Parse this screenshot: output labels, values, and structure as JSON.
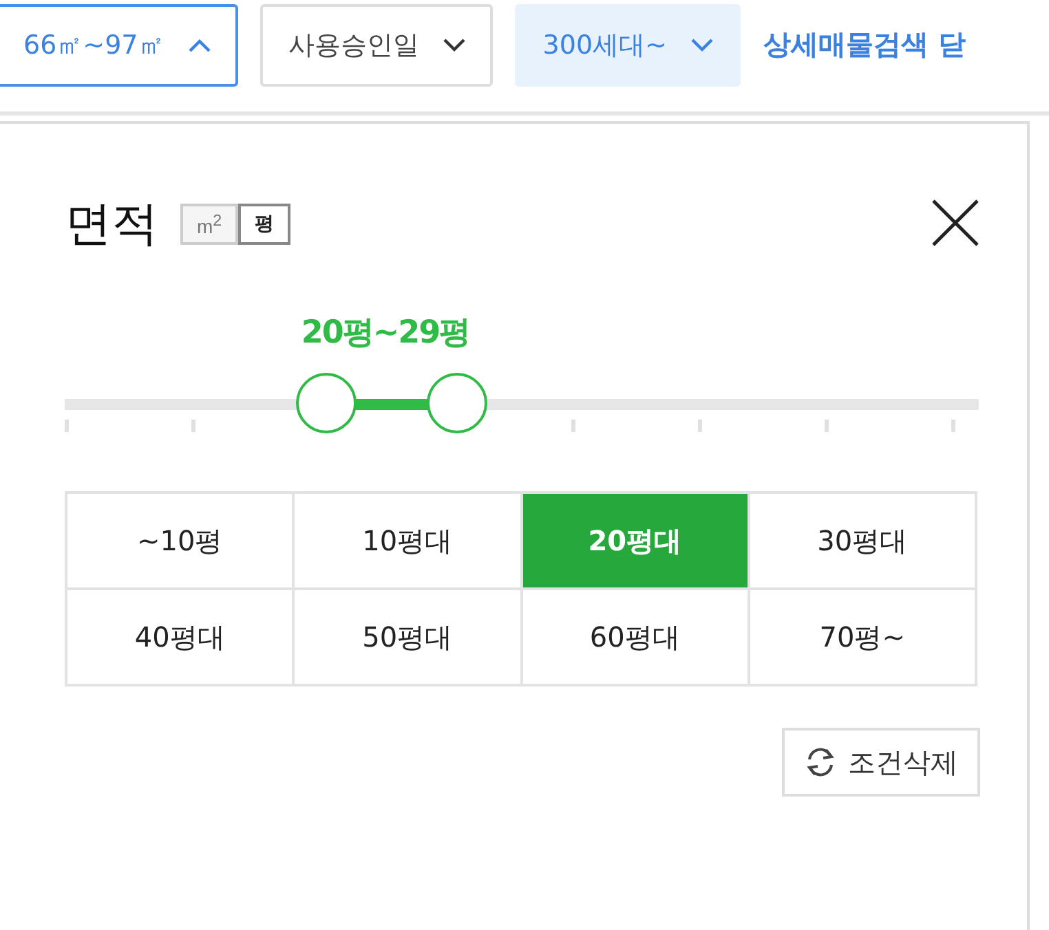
{
  "filters": [
    {
      "label": "66㎡~97㎡",
      "kind": "active",
      "expanded": true
    },
    {
      "label": "사용승인일",
      "kind": "plain",
      "expanded": false
    },
    {
      "label": "300세대~",
      "kind": "applied",
      "expanded": false
    }
  ],
  "detail_link": "상세매물검색 닫",
  "panel": {
    "title": "면적",
    "units": [
      {
        "label": "m$^{2}$",
        "selected": false
      },
      {
        "label": "평",
        "selected": true
      }
    ],
    "range_label": "20평~29평",
    "range": {
      "low": {
        "level": 0.2857
      },
      "high": {
        "level": 0.4286
      }
    },
    "options": [
      {
        "label": "~10평",
        "selected": false
      },
      {
        "label": "10평대",
        "selected": false
      },
      {
        "label": "20평대",
        "selected": true
      },
      {
        "label": "30평대",
        "selected": false
      },
      {
        "label": "40평대",
        "selected": false
      },
      {
        "label": "50평대",
        "selected": false
      },
      {
        "label": "60평대",
        "selected": false
      },
      {
        "label": "70평~",
        "selected": false
      }
    ],
    "reset_button": "조건삭제"
  }
}
